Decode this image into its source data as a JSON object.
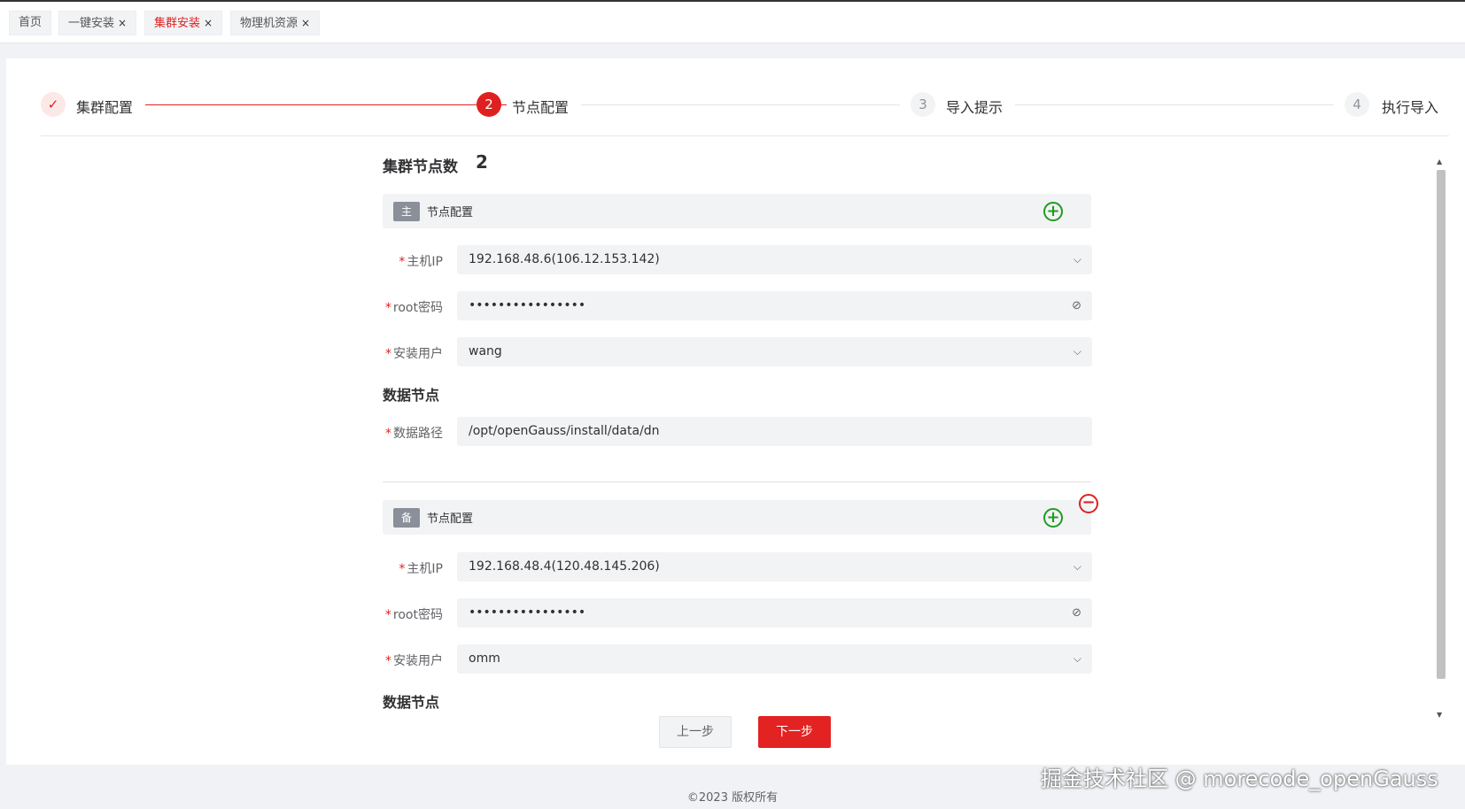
{
  "tabs": [
    {
      "label": "首页",
      "closable": false,
      "active": false
    },
    {
      "label": "一键安装",
      "closable": true,
      "active": false
    },
    {
      "label": "集群安装",
      "closable": true,
      "active": true
    },
    {
      "label": "物理机资源",
      "closable": true,
      "active": false
    }
  ],
  "tab_close_symbol": "×",
  "steps": [
    {
      "index": "✓",
      "label": "集群配置",
      "state": "done"
    },
    {
      "index": "2",
      "label": "节点配置",
      "state": "active"
    },
    {
      "index": "3",
      "label": "导入提示",
      "state": "pending"
    },
    {
      "index": "4",
      "label": "执行导入",
      "state": "pending"
    }
  ],
  "cluster": {
    "count_label": "集群节点数",
    "count_value": "2"
  },
  "nodes": [
    {
      "badge": "主",
      "title": "节点配置",
      "host_label": "主机IP",
      "host_value": "192.168.48.6(106.12.153.142)",
      "pwd_label": "root密码",
      "pwd_value": "••••••••••••••••",
      "user_label": "安装用户",
      "user_value": "wang",
      "data_title": "数据节点",
      "path_label": "数据路径",
      "path_value": "/opt/openGauss/install/data/dn"
    },
    {
      "badge": "备",
      "title": "节点配置",
      "host_label": "主机IP",
      "host_value": "192.168.48.4(120.48.145.206)",
      "pwd_label": "root密码",
      "pwd_value": "••••••••••••••••",
      "user_label": "安装用户",
      "user_value": "omm",
      "data_title": "数据节点"
    }
  ],
  "required_mark": "*",
  "icons": {
    "plus": "plus-circle-icon",
    "minus": "minus-circle-icon",
    "chevron": "chevron-down-icon",
    "eye": "eye-off-icon"
  },
  "buttons": {
    "prev": "上一步",
    "next": "下一步"
  },
  "footer": "©2023 版权所有",
  "watermark": "掘金技术社区 @ morecode_openGauss",
  "colors": {
    "accent": "#e02020",
    "add": "#1f9c1f"
  }
}
